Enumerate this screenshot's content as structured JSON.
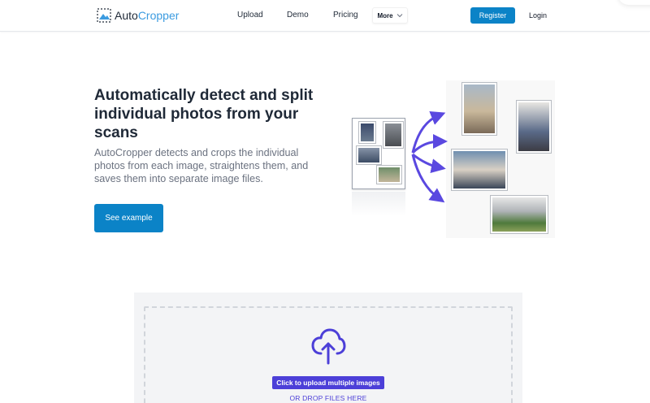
{
  "brand": {
    "name_part1": "Auto",
    "name_part2": "Cropper",
    "accent": "#3b9be0"
  },
  "nav": {
    "links": [
      "Upload",
      "Demo",
      "Pricing"
    ],
    "more_label": "More",
    "register_label": "Register",
    "login_label": "Login"
  },
  "hero": {
    "title": "Automatically detect and split individual photos from your scans",
    "description": "AutoCropper detects and crops the individual photos from each image, straightens them, and saves them into separate image files.",
    "cta_label": "See example"
  },
  "upload": {
    "button_label": "Click to upload multiple images",
    "drop_text": "OR DROP FILES HERE"
  },
  "colors": {
    "primary": "#0b83c7",
    "upload_accent": "#4c3fd8",
    "arrow": "#5a48e0"
  }
}
